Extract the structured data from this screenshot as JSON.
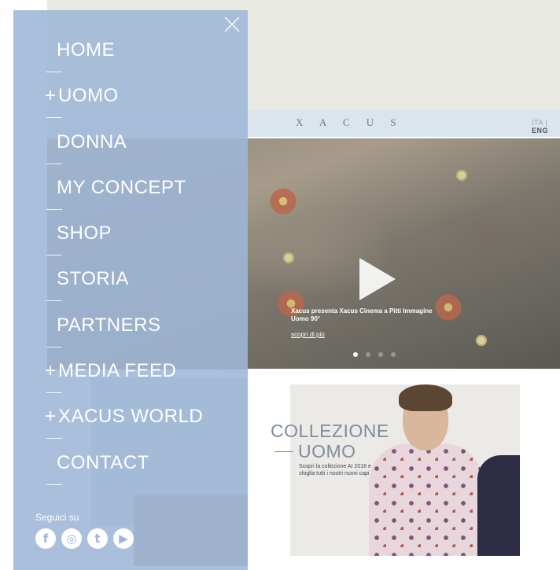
{
  "site": {
    "brand": "X A C U S",
    "lang_ita": "ITA",
    "lang_eng": "ENG"
  },
  "hero": {
    "caption": "Xacus presenta Xacus Cinema a Pitti Immagine Uomo 90°",
    "link": "scopri di più",
    "slides": 4,
    "active_slide": 1
  },
  "collection": {
    "title_line1": "COLLEZIONE",
    "title_line2": "UOMO",
    "text": "Scopri la collezione AI 2016 e sfoglia tutti i nostri nuovi capi"
  },
  "sidebar": {
    "background": "#9eb6d6",
    "items": [
      {
        "label": "HOME",
        "expandable": false
      },
      {
        "label": "UOMO",
        "expandable": true
      },
      {
        "label": "DONNA",
        "expandable": false
      },
      {
        "label": "MY CONCEPT",
        "expandable": false
      },
      {
        "label": "SHOP",
        "expandable": false
      },
      {
        "label": "STORIA",
        "expandable": false
      },
      {
        "label": "PARTNERS",
        "expandable": false
      },
      {
        "label": "MEDIA FEED",
        "expandable": true
      },
      {
        "label": "XACUS WORLD",
        "expandable": true
      },
      {
        "label": "CONTACT",
        "expandable": false
      }
    ],
    "plus_symbol": "+",
    "follow_label": "Seguici su",
    "socials": [
      {
        "icon": "facebook-icon",
        "glyph": "f"
      },
      {
        "icon": "instagram-icon",
        "glyph": "◎"
      },
      {
        "icon": "twitter-icon",
        "glyph": "t"
      },
      {
        "icon": "youtube-icon",
        "glyph": "▶"
      }
    ]
  }
}
